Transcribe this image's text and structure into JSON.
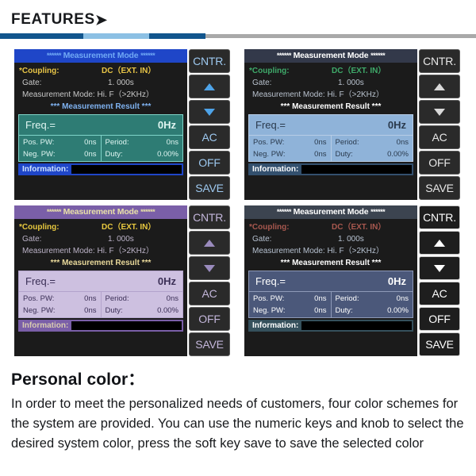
{
  "header": {
    "title": "FEATURES",
    "arrow_icon": "chevron-right-icon",
    "rule_colors": [
      "#11558d",
      "#8cc0e4",
      "#11558d",
      "#a9a9a9"
    ]
  },
  "screen_labels": {
    "title_stars_left": "******",
    "title_text": "Measurement Mode",
    "title_stars_right": "******",
    "coupling_label": "*Coupling:",
    "coupling_value": "DC（EXT. IN）",
    "gate_label": "Gate:",
    "gate_value": "1. 000s",
    "mode_label": "Measurement Mode:",
    "mode_value": "Hi. F（>2KHz）",
    "result_header": "*** Measurement Result ***",
    "freq_label": "Freq.=",
    "freq_value": "0Hz",
    "pos_pw_label": "Pos. PW:",
    "pos_pw_value": "0ns",
    "neg_pw_label": "Neg. PW:",
    "neg_pw_value": "0ns",
    "period_label": "Period:",
    "period_value": "0ns",
    "duty_label": "Duty:",
    "duty_value": "0.00%",
    "information_label": "Information:",
    "information_value": ""
  },
  "softkeys": [
    {
      "label": "CNTR.",
      "icon": ""
    },
    {
      "label": "",
      "icon": "triangle-up-icon"
    },
    {
      "label": "",
      "icon": "triangle-down-icon"
    },
    {
      "label": "AC",
      "icon": ""
    },
    {
      "label": "OFF",
      "icon": ""
    },
    {
      "label": "SAVE",
      "icon": ""
    }
  ],
  "panels": [
    {
      "name": "color-scheme-blue",
      "theme": {
        "screen_bg": "#1b1b1b",
        "title_bg": "#1f46c8",
        "title_fg": "#6fa8f5",
        "label_fg": "#c8c8c8",
        "accent_fg": "#e8c547",
        "result_header_fg": "#7fb2f0",
        "box_bg": "#2e7c74",
        "box_border": "#7fd4c8",
        "box_fg": "#dff5f1",
        "info_bg": "#1f46c8",
        "info_fg": "#cfe3ff",
        "key_bg": "#2a2a2a",
        "key_border": "#565656",
        "key_fg": "#9ec9f0",
        "tri_fg": "#4ea3e8"
      }
    },
    {
      "name": "color-scheme-green",
      "theme": {
        "screen_bg": "#1b1b1b",
        "title_bg": "#33394a",
        "title_fg": "#ffffff",
        "label_fg": "#b9c2ce",
        "accent_fg": "#3faa6a",
        "result_header_fg": "#ffffff",
        "box_bg": "#8fb3d9",
        "box_border": "#b7cde6",
        "box_fg": "#2a3a4d",
        "info_bg": "#33506e",
        "info_fg": "#ffffff",
        "key_bg": "#2a2a2a",
        "key_border": "#5a5a5a",
        "key_fg": "#e8e8e8",
        "tri_fg": "#d8d8d8"
      }
    },
    {
      "name": "color-scheme-purple",
      "theme": {
        "screen_bg": "#1b1b1b",
        "title_bg": "#7a5fa8",
        "title_fg": "#e8e0a8",
        "label_fg": "#bdb4c9",
        "accent_fg": "#e8c93f",
        "result_header_fg": "#e8d89a",
        "box_bg": "#cdc0e0",
        "box_border": "#b3a3cc",
        "box_fg": "#3b2f56",
        "info_bg": "#7a5fa8",
        "info_fg": "#d9ccb0",
        "key_bg": "#2a2a2a",
        "key_border": "#5a5a5a",
        "key_fg": "#c3b6da",
        "tri_fg": "#9a8bbd"
      }
    },
    {
      "name": "color-scheme-slate",
      "theme": {
        "screen_bg": "#1b1b1b",
        "title_bg": "#3c4450",
        "title_fg": "#ffffff",
        "label_fg": "#b7c2d1",
        "accent_fg": "#a8584f",
        "result_header_fg": "#ffffff",
        "box_bg": "#4b587a",
        "box_border": "#8e9ab8",
        "box_fg": "#ffffff",
        "info_bg": "#35505c",
        "info_fg": "#ffffff",
        "key_bg": "#1e1e1e",
        "key_border": "#c9c9c9",
        "key_fg": "#ffffff",
        "tri_fg": "#ffffff"
      }
    }
  ],
  "copy": {
    "title": "Personal color：",
    "body": "In order to meet the personalized needs of customers, four color schemes for the system are provided. You can use the numeric keys and knob to select the desired system color, press the soft key save to save the selected color"
  }
}
